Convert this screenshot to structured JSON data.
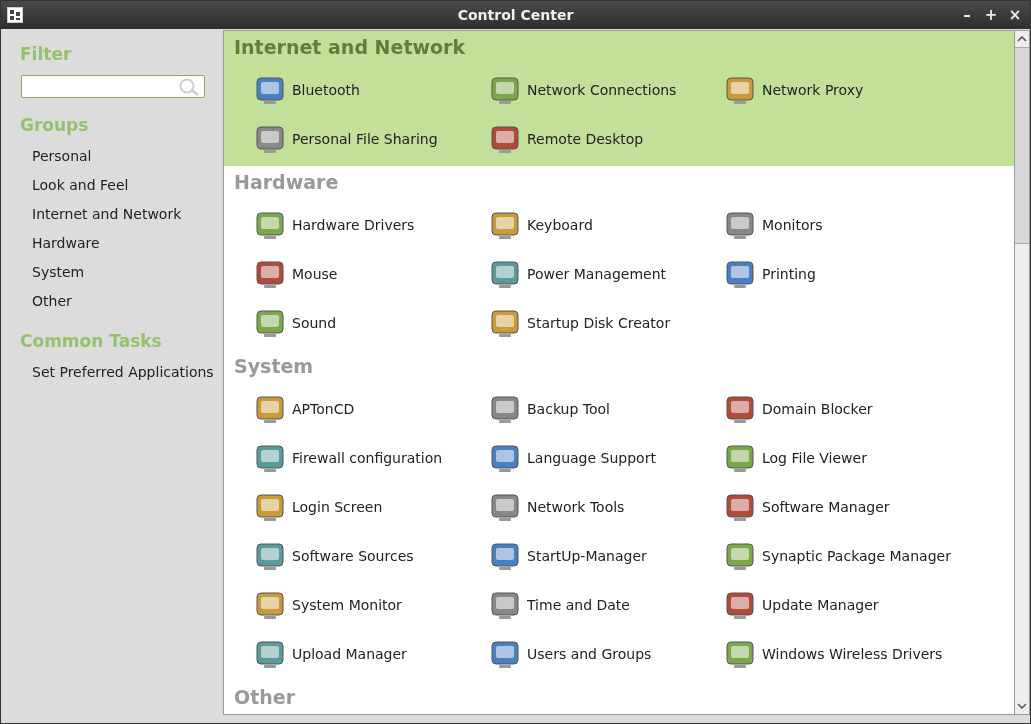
{
  "window": {
    "title": "Control Center",
    "controls": [
      "–",
      "+",
      "×"
    ]
  },
  "sidebar": {
    "filter_heading": "Filter",
    "groups_heading": "Groups",
    "groups": [
      "Personal",
      "Look and Feel",
      "Internet and Network",
      "Hardware",
      "System",
      "Other"
    ],
    "tasks_heading": "Common Tasks",
    "tasks": [
      "Set Preferred Applications"
    ]
  },
  "sections": [
    {
      "title": "Internet and Network",
      "selected": true,
      "items": [
        "Bluetooth",
        "Network Connections",
        "Network Proxy",
        "Personal File Sharing",
        "Remote Desktop"
      ]
    },
    {
      "title": "Hardware",
      "selected": false,
      "items": [
        "Hardware Drivers",
        "Keyboard",
        "Monitors",
        "Mouse",
        "Power Management",
        "Printing",
        "Sound",
        "Startup Disk Creator"
      ]
    },
    {
      "title": "System",
      "selected": false,
      "items": [
        "APTonCD",
        "Backup Tool",
        "Domain Blocker",
        "Firewall configuration",
        "Language Support",
        "Log File Viewer",
        "Login Screen",
        "Network Tools",
        "Software Manager",
        "Software Sources",
        "StartUp-Manager",
        "Synaptic Package Manager",
        "System Monitor",
        "Time and Date",
        "Update Manager",
        "Upload Manager",
        "Users and Groups",
        "Windows Wireless Drivers"
      ]
    },
    {
      "title": "Other",
      "selected": false
    }
  ]
}
